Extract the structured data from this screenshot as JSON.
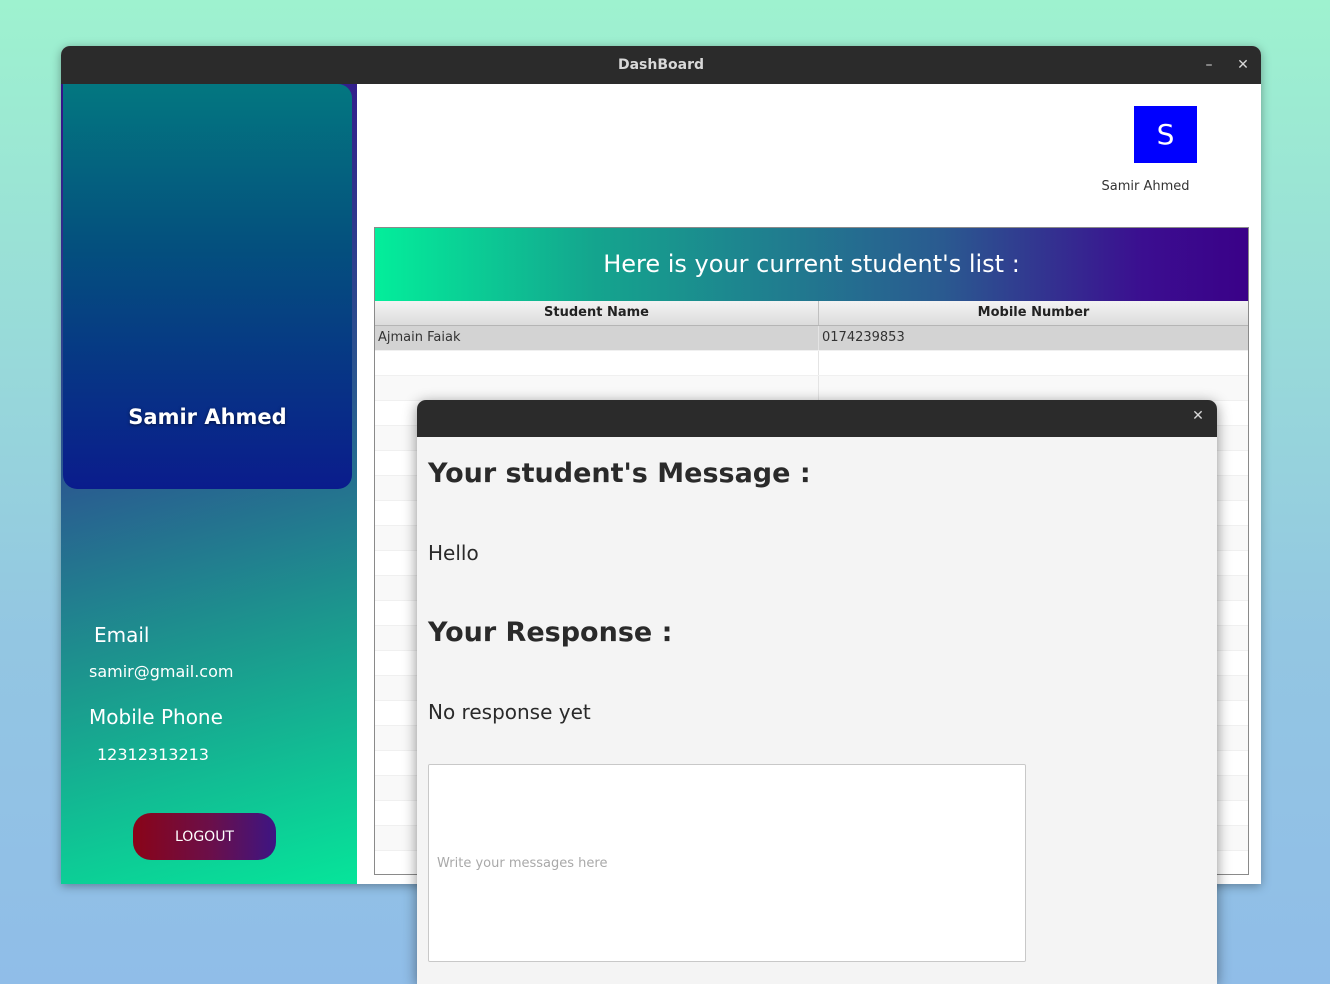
{
  "window": {
    "title": "DashBoard",
    "minimize_label": "–",
    "close_label": "✕"
  },
  "sidebar": {
    "profile_name": "Samir Ahmed",
    "email_label": "Email",
    "email_value": "samir@gmail.com",
    "phone_label": "Mobile Phone",
    "phone_value": "12312313213",
    "logout_label": "LOGOUT"
  },
  "header": {
    "avatar_letter": "S",
    "avatar_color": "#0000ff",
    "user_name": "Samir Ahmed"
  },
  "students": {
    "banner": "Here is your current student's list :",
    "columns": [
      "Student Name",
      "Mobile Number"
    ],
    "rows": [
      {
        "name": "Ajmain Faiak",
        "mobile": "0174239853"
      }
    ]
  },
  "dialog": {
    "close_label": "✕",
    "message_heading": "Your student's Message :",
    "message_text": "Hello",
    "response_heading": "Your Response :",
    "response_text": "No response yet",
    "input_placeholder": "Write your messages here"
  }
}
